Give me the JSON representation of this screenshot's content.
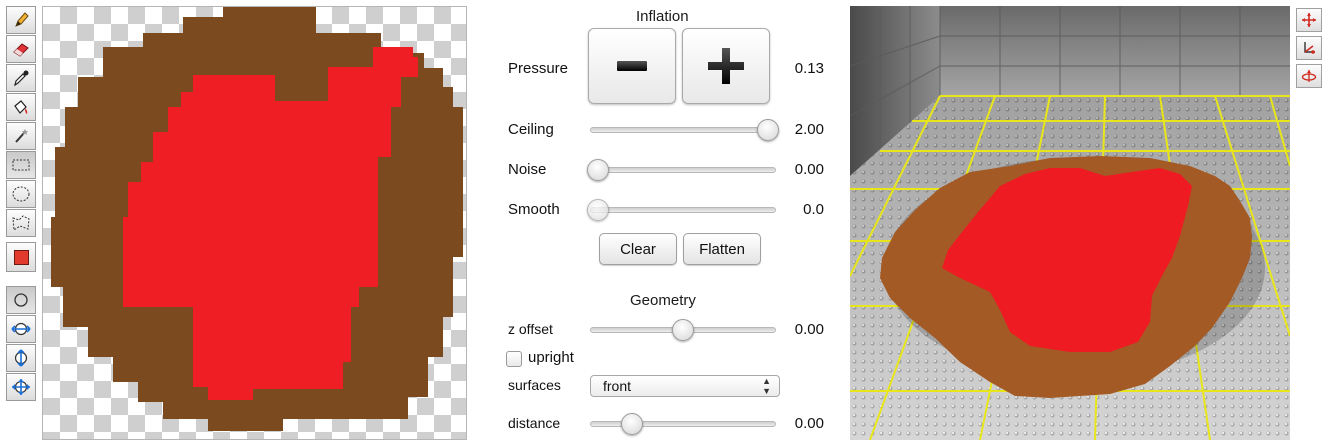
{
  "toolbar": {
    "tools": [
      {
        "name": "pencil-icon"
      },
      {
        "name": "eraser-icon"
      },
      {
        "name": "eyedropper-icon"
      },
      {
        "name": "paint-bucket-icon"
      },
      {
        "name": "magic-wand-icon"
      },
      {
        "name": "rect-select-icon"
      },
      {
        "name": "ellipse-select-icon"
      },
      {
        "name": "lasso-select-icon"
      }
    ],
    "current_color": "#e23b2e",
    "brushes": [
      {
        "name": "brush-circle-icon"
      },
      {
        "name": "brush-arrows-h-icon"
      },
      {
        "name": "brush-arrows-v-icon"
      },
      {
        "name": "brush-arrows-all-icon"
      }
    ]
  },
  "colors": {
    "brown": "#7b4a1f",
    "red": "#ef1e24",
    "brown3d": "#a35a25",
    "red3d": "#ee1c22",
    "grid_line": "#e8e61a"
  },
  "inflation": {
    "title": "Inflation",
    "pressure": {
      "label": "Pressure",
      "value": "0.13"
    },
    "ceiling": {
      "label": "Ceiling",
      "value": "2.00",
      "level": 1.0
    },
    "noise": {
      "label": "Noise",
      "value": "0.00",
      "level": 0.0
    },
    "smooth": {
      "label": "Smooth",
      "value": "0.0",
      "level": 0.0
    },
    "clear_label": "Clear",
    "flatten_label": "Flatten"
  },
  "geometry": {
    "title": "Geometry",
    "z_offset": {
      "label": "z offset",
      "value": "0.00",
      "level": 0.5
    },
    "upright": {
      "label": "upright",
      "checked": false
    },
    "surfaces": {
      "label": "surfaces",
      "selected": "front"
    },
    "distance": {
      "label": "distance",
      "value": "0.00",
      "level": 0.2
    }
  },
  "view_tools": [
    {
      "name": "move-arrows-icon"
    },
    {
      "name": "axis-rotate-icon"
    },
    {
      "name": "orbit-icon"
    }
  ]
}
